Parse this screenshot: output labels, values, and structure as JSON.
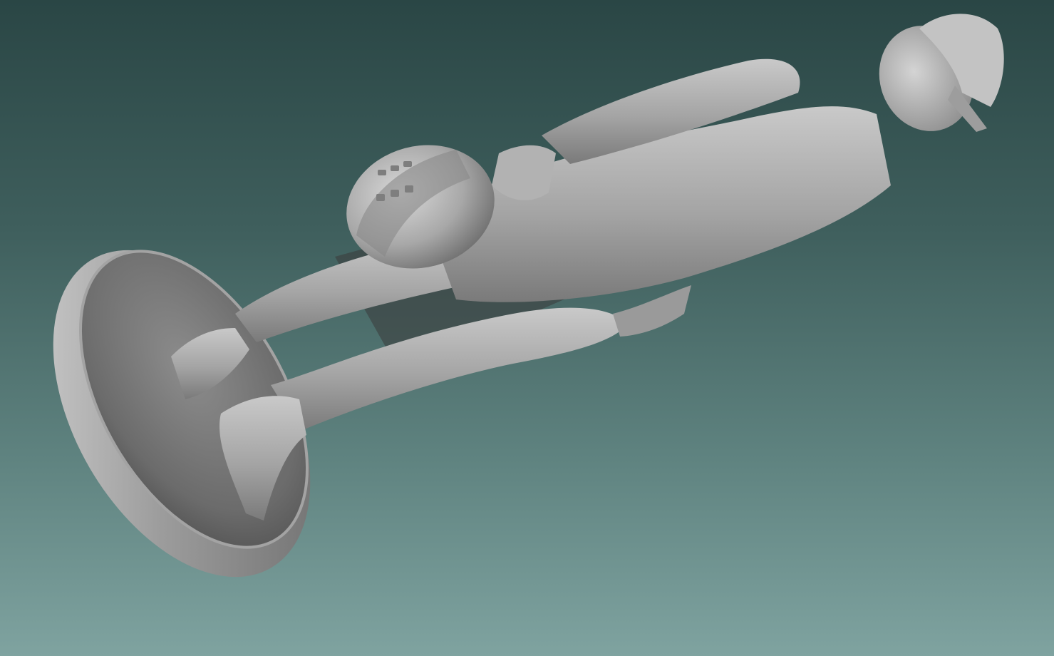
{
  "viewport": {
    "background_top": "#2a4645",
    "background_bottom": "#7fa3a0",
    "model_color": "#a9a9a9"
  },
  "scene": {
    "subject": "sculpted-race-driver-figure",
    "parts": [
      "base-disc",
      "figure-legs",
      "figure-torso",
      "figure-arm",
      "helmet",
      "head-with-cap"
    ]
  }
}
